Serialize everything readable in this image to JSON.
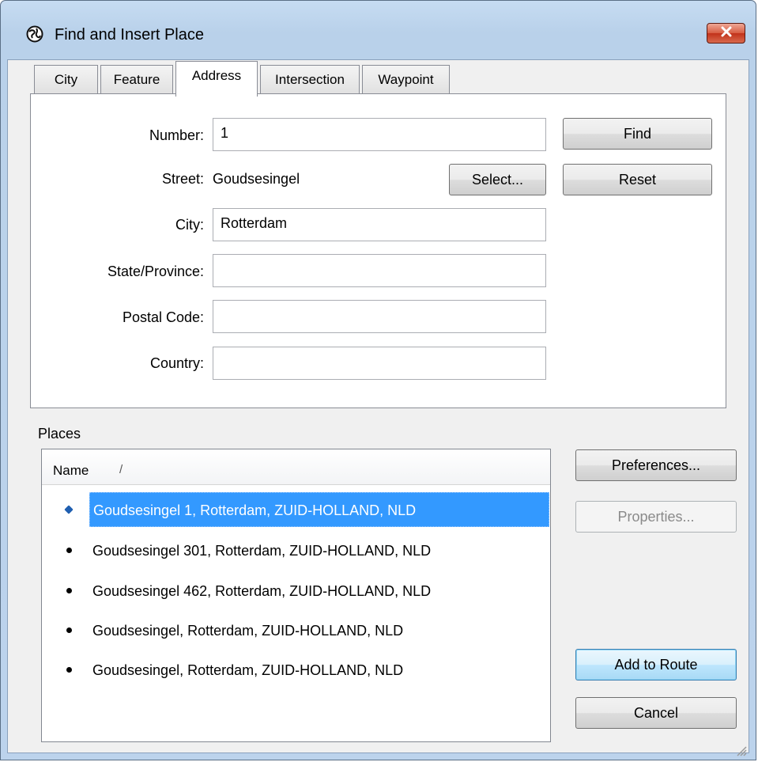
{
  "window": {
    "title": "Find and Insert Place"
  },
  "tabs": [
    {
      "label": "City"
    },
    {
      "label": "Feature"
    },
    {
      "label": "Address"
    },
    {
      "label": "Intersection"
    },
    {
      "label": "Waypoint"
    }
  ],
  "address": {
    "number_label": "Number:",
    "number_value": "1",
    "street_label": "Street:",
    "street_value": "Goudsesingel",
    "select_button": "Select...",
    "city_label": "City:",
    "city_value": "Rotterdam",
    "state_label": "State/Province:",
    "state_value": "",
    "postal_label": "Postal Code:",
    "postal_value": "",
    "country_label": "Country:",
    "country_value": ""
  },
  "buttons": {
    "find": "Find",
    "reset": "Reset",
    "preferences": "Preferences...",
    "properties": "Properties...",
    "add_to_route": "Add to Route",
    "cancel": "Cancel"
  },
  "places": {
    "label": "Places",
    "column_name": "Name",
    "sort_indicator": "/",
    "items": [
      {
        "text": "Goudsesingel 1, Rotterdam, ZUID-HOLLAND, NLD",
        "selected": true
      },
      {
        "text": "Goudsesingel 301, Rotterdam, ZUID-HOLLAND, NLD",
        "selected": false
      },
      {
        "text": "Goudsesingel 462, Rotterdam, ZUID-HOLLAND, NLD",
        "selected": false
      },
      {
        "text": "Goudsesingel, Rotterdam, ZUID-HOLLAND, NLD",
        "selected": false
      },
      {
        "text": "Goudsesingel, Rotterdam, ZUID-HOLLAND, NLD",
        "selected": false
      }
    ]
  },
  "colors": {
    "selection": "#3399ff",
    "title_gradient": "#c6dcf2",
    "close_button": "#d75c41"
  },
  "icons": {
    "title": "globe-icon",
    "close": "close-icon",
    "grip": "resize-grip-icon"
  }
}
